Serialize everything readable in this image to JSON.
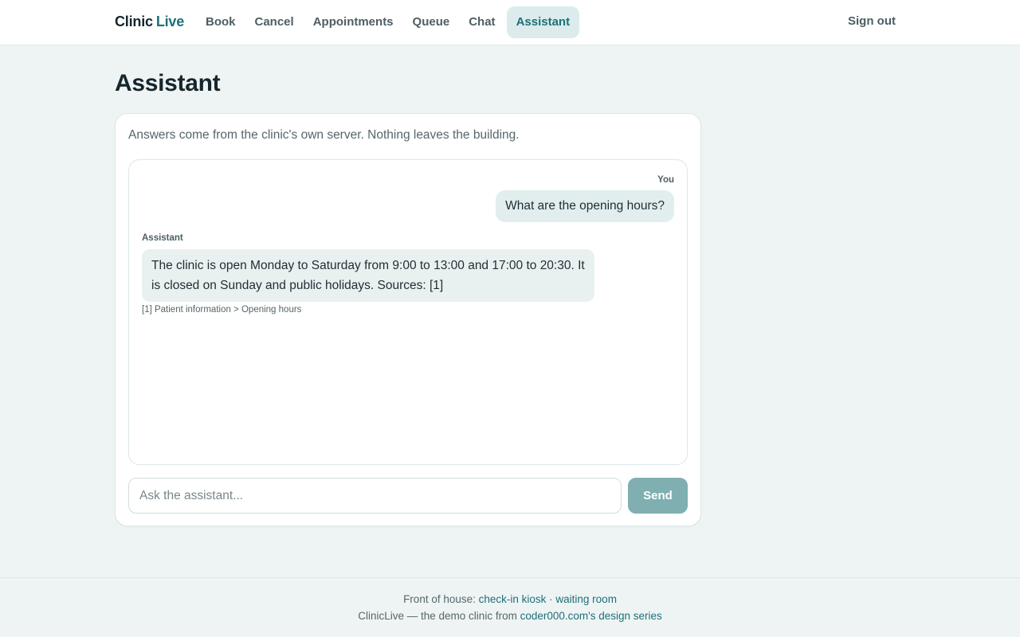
{
  "brand": {
    "name_part1": "Clinic",
    "name_part2": "Live"
  },
  "nav": {
    "items": [
      {
        "label": "Book"
      },
      {
        "label": "Cancel"
      },
      {
        "label": "Appointments"
      },
      {
        "label": "Queue"
      },
      {
        "label": "Chat"
      },
      {
        "label": "Assistant",
        "active": true
      }
    ],
    "sign_out": "Sign out"
  },
  "page": {
    "title": "Assistant"
  },
  "assistant": {
    "note": "Answers come from the clinic's own server. Nothing leaves the building.",
    "messages": [
      {
        "role_label": "You",
        "text": "What are the opening hours?"
      },
      {
        "role_label": "Assistant",
        "text": "The clinic is open Monday to Saturday from 9:00 to 13:00 and 17:00 to 20:30. It is closed on Sunday and public holidays. Sources: [1]",
        "source": "[1] Patient information > Opening hours"
      }
    ],
    "input": {
      "placeholder": "Ask the assistant...",
      "value": ""
    },
    "send_label": "Send"
  },
  "footer": {
    "line1_prefix": "Front of house: ",
    "link_checkin": "check-in kiosk",
    "separator": " · ",
    "link_waiting": "waiting room",
    "line2_prefix": "ClinicLive — the demo clinic from ",
    "link_series": "coder000.com's design series"
  },
  "colors": {
    "accent": "#1f6f78",
    "active_tab_bg": "#dcecec",
    "send_button_bg": "#7fafb1",
    "page_bg": "#eef4f4"
  }
}
